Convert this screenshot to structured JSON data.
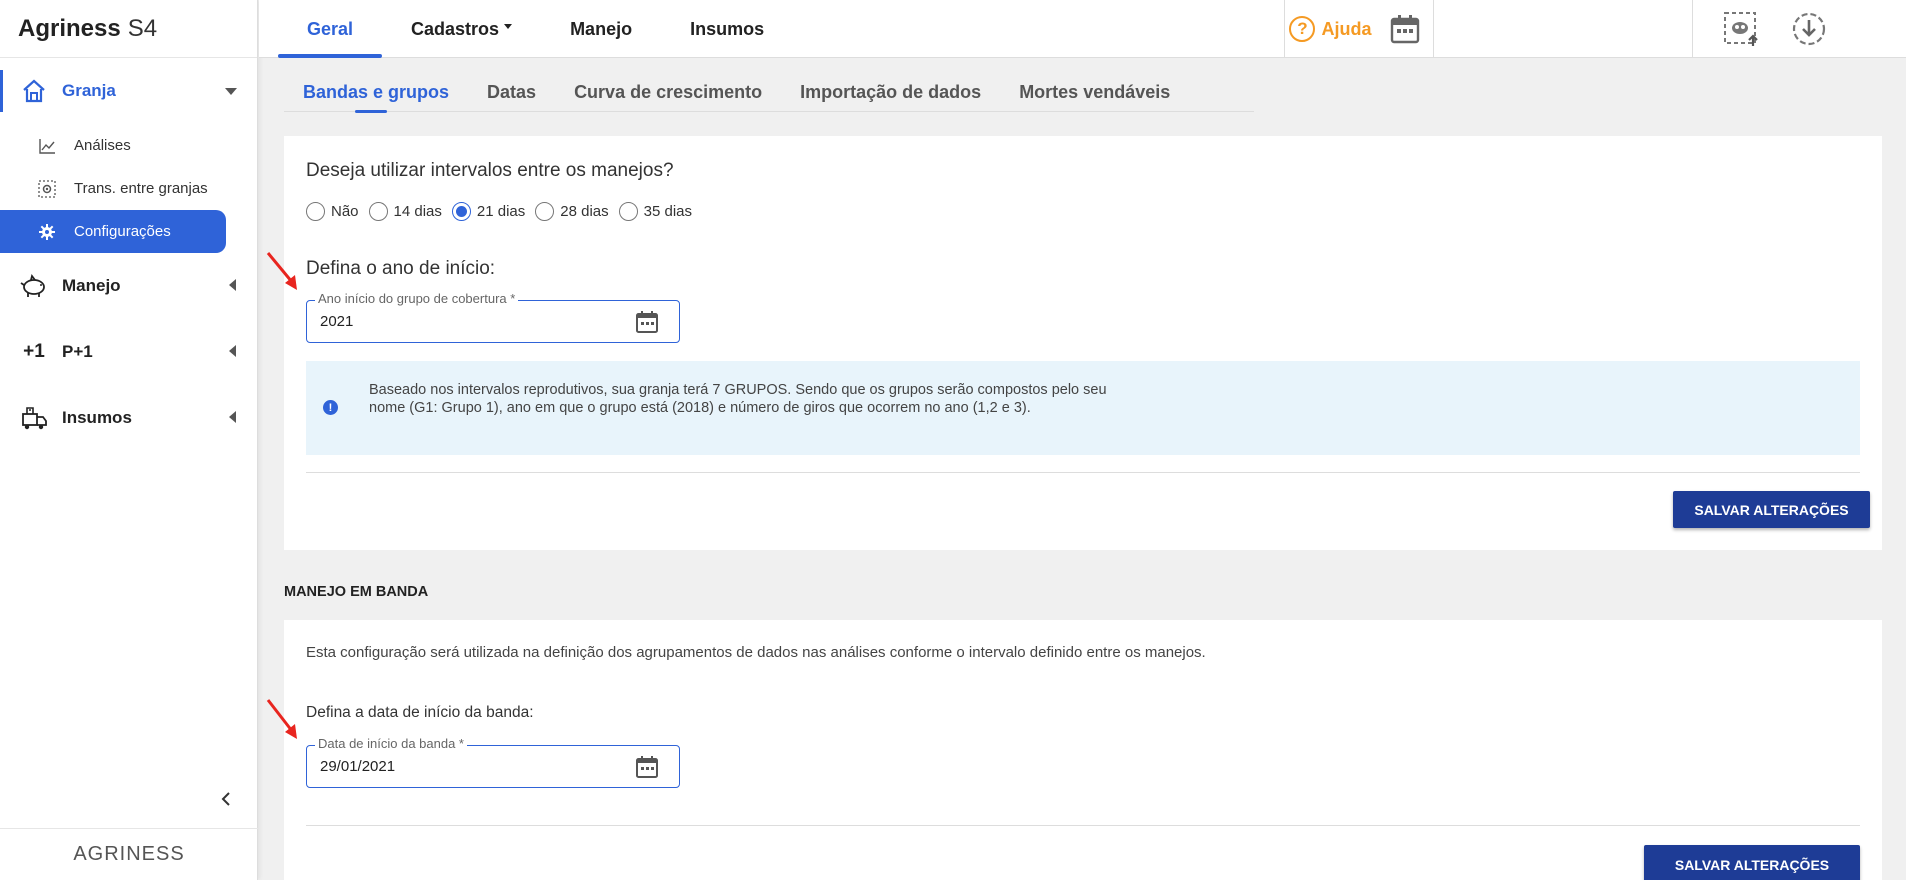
{
  "brand": {
    "name": "Agriness",
    "version": "S4"
  },
  "sidebar": {
    "sections": [
      {
        "label": "Granja",
        "icon": "house-icon",
        "active": true
      },
      {
        "label": "Manejo",
        "icon": "pig-icon"
      },
      {
        "label": "P+1",
        "icon": "plus-one-icon"
      },
      {
        "label": "Insumos",
        "icon": "supplies-icon"
      }
    ],
    "sub_items": [
      {
        "label": "Análises",
        "icon": "chart-line-icon"
      },
      {
        "label": "Trans. entre granjas",
        "icon": "transfer-icon"
      },
      {
        "label": "Configurações",
        "icon": "gear-icon",
        "active": true
      }
    ],
    "p1_badge": "+1",
    "footer_logo": "AGRINESS"
  },
  "topnav": {
    "items": [
      "Geral",
      "Cadastros",
      "Manejo",
      "Insumos"
    ],
    "active": "Geral",
    "help_label": "Ajuda"
  },
  "tabs": {
    "items": [
      "Bandas e grupos",
      "Datas",
      "Curva de crescimento",
      "Importação de dados",
      "Mortes vendáveis"
    ],
    "active": "Bandas e grupos"
  },
  "intervals": {
    "question": "Deseja utilizar intervalos entre os manejos?",
    "options": [
      "Não",
      "14 dias",
      "21 dias",
      "28 dias",
      "35 dias"
    ],
    "selected": "21 dias"
  },
  "start_year": {
    "title": "Defina o ano de início:",
    "field_label": "Ano início do grupo de cobertura *",
    "field_value": "2021"
  },
  "info": {
    "text": "Baseado nos intervalos reprodutivos, sua granja terá 7 GRUPOS. Sendo que os grupos serão compostos pelo seu nome (G1: Grupo 1), ano em que o grupo está (2018) e número de giros que ocorrem no ano (1,2 e 3)."
  },
  "save_label": "SALVAR ALTERAÇÕES",
  "manejo_banda": {
    "heading": "MANEJO EM BANDA",
    "description": "Esta configuração será utilizada na definição dos agrupamentos de dados nas análises conforme o intervalo definido entre os manejos.",
    "title": "Defina a data de início da banda:",
    "field_label": "Data de início da banda *",
    "field_value": "29/01/2021"
  },
  "colors": {
    "accent": "#2f63d8",
    "help": "#f59a23",
    "button": "#1e3c96",
    "info_bg": "#e8f4fb",
    "annotation_arrow": "#e8251f"
  }
}
